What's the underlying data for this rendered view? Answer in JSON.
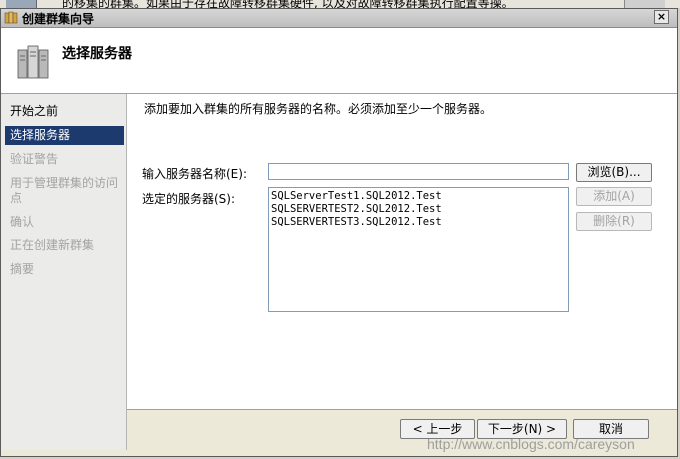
{
  "backdrop": {
    "text": "的移集的群集。如果由于存在故障转移群集硬件, 以及对故障转移群集执行配置等操。"
  },
  "window": {
    "title": "创建群集向导",
    "close_glyph": "×"
  },
  "header": {
    "title": "选择服务器"
  },
  "nav": {
    "items": [
      {
        "label": "开始之前",
        "state": "normal"
      },
      {
        "label": "选择服务器",
        "state": "active"
      },
      {
        "label": "验证警告",
        "state": "disabled"
      },
      {
        "label": "用于管理群集的访问点",
        "state": "disabled"
      },
      {
        "label": "确认",
        "state": "disabled"
      },
      {
        "label": "正在创建新群集",
        "state": "disabled"
      },
      {
        "label": "摘要",
        "state": "disabled"
      }
    ]
  },
  "main": {
    "instruction": "添加要加入群集的所有服务器的名称。必须添加至少一个服务器。",
    "server_name_label": "输入服务器名称(E):",
    "server_name_value": "",
    "selected_label": "选定的服务器(S):",
    "selected_servers": [
      "SQLServerTest1.SQL2012.Test",
      "SQLSERVERTEST2.SQL2012.Test",
      "SQLSERVERTEST3.SQL2012.Test"
    ],
    "browse_label": "浏览(B)...",
    "add_label": "添加(A)",
    "remove_label": "删除(R)"
  },
  "footer": {
    "back_label": "< 上一步",
    "next_label": "下一步(N) >",
    "cancel_label": "取消"
  },
  "watermark": "http://www.cnblogs.com/careyson",
  "colors": {
    "nav_active": "#1c3a6e",
    "disabled_text": "#a3a3a3"
  }
}
